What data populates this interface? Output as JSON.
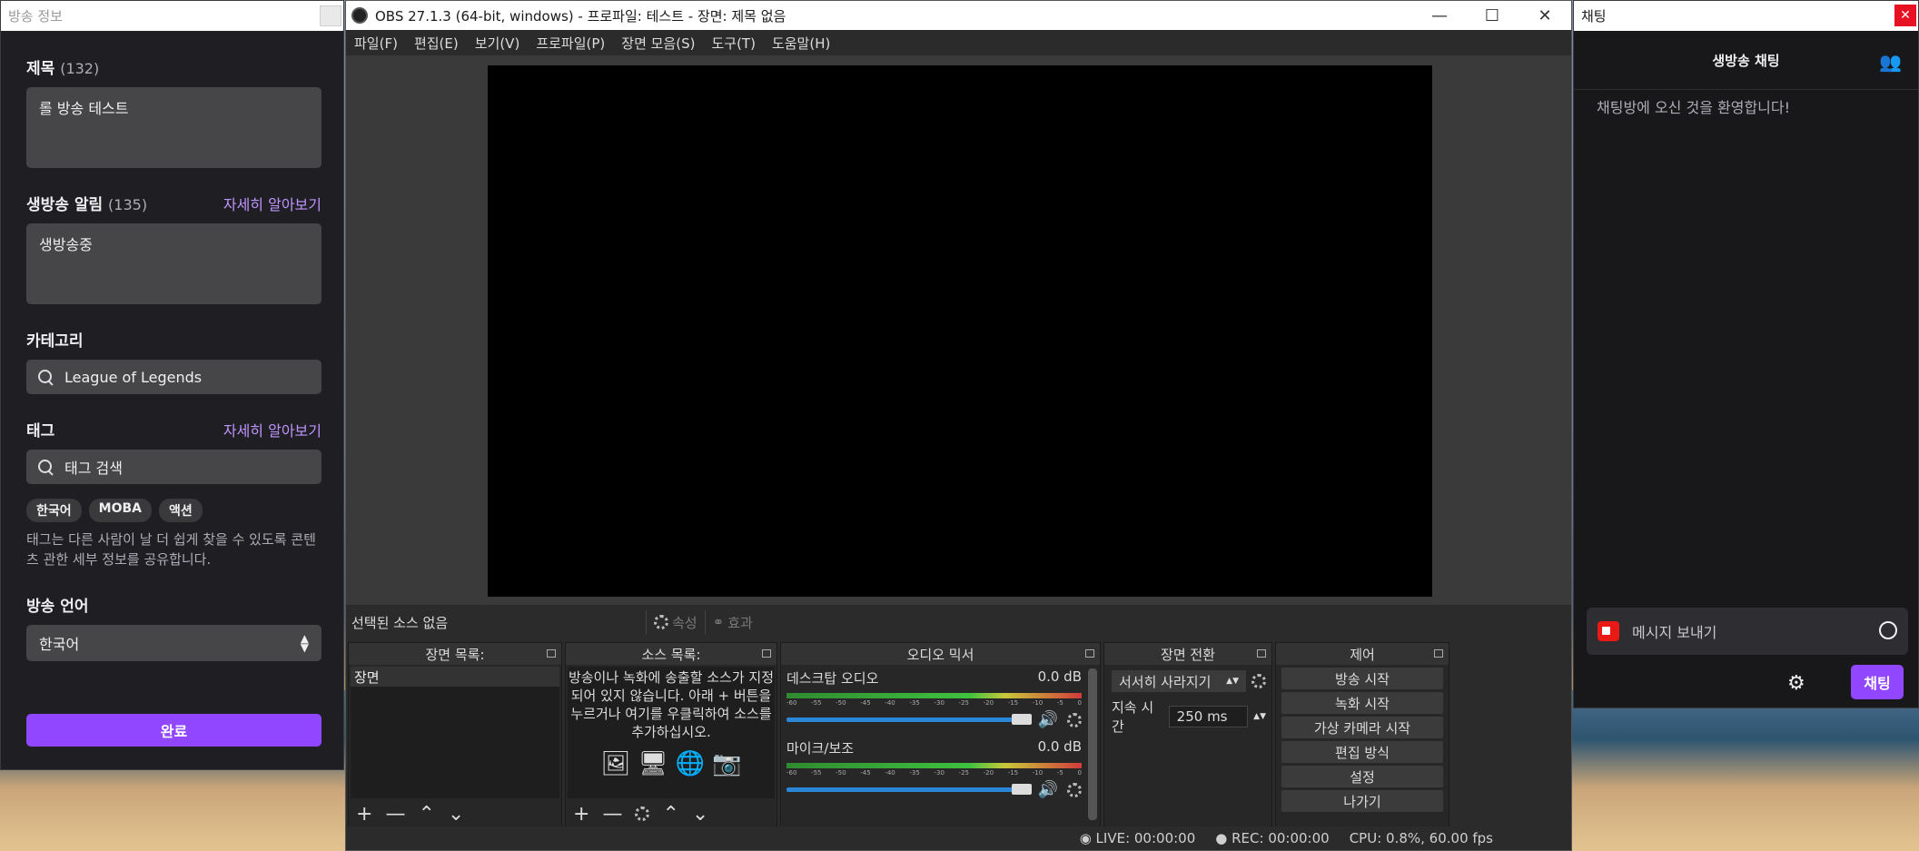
{
  "info_window": {
    "title": "방송 정보",
    "title_label": "제목",
    "title_count": "(132)",
    "title_value": "롤 방송 테스트",
    "notif_label": "생방송 알림",
    "notif_count": "(135)",
    "learn_more": "자세히 알아보기",
    "notif_value": "생방송중",
    "category_label": "카테고리",
    "category_value": "League of Legends",
    "tags_label": "태그",
    "tag_search_placeholder": "태그 검색",
    "tags": [
      "한국어",
      "MOBA",
      "액션"
    ],
    "tags_hint": "태그는 다른 사람이 날 더 쉽게 찾을 수 있도록 콘텐츠 관한 세부 정보를 공유합니다.",
    "language_label": "방송 언어",
    "language_value": "한국어",
    "done_label": "완료"
  },
  "obs": {
    "title": "OBS 27.1.3 (64-bit, windows) - 프로파일: 테스트 - 장면: 제목 없음",
    "menu": [
      "파일(F)",
      "편집(E)",
      "보기(V)",
      "프로파일(P)",
      "장면 모음(S)",
      "도구(T)",
      "도움말(H)"
    ],
    "no_source": "선택된 소스 없음",
    "props_label": "속성",
    "filters_label": "효과",
    "scenes_title": "장면 목록:",
    "scene_item": "장면",
    "sources_title": "소스 목록:",
    "sources_hint": "방송이나 녹화에 송출할 소스가 지정되어 있지 않습니다. 아래 + 버튼을 누르거나 여기를 우클릭하여 소스를 추가하십시오.",
    "mixer_title": "오디오 믹서",
    "channels": [
      {
        "name": "데스크탑 오디오",
        "db": "0.0 dB"
      },
      {
        "name": "마이크/보조",
        "db": "0.0 dB"
      }
    ],
    "meter_ticks": [
      "-60",
      "-55",
      "-50",
      "-45",
      "-40",
      "-35",
      "-30",
      "-25",
      "-20",
      "-15",
      "-10",
      "-5",
      "0"
    ],
    "transitions_title": "장면 전환",
    "transition_value": "서서히 사라지기",
    "duration_label": "지속 시간",
    "duration_value": "250 ms",
    "controls_title": "제어",
    "controls": [
      "방송 시작",
      "녹화 시작",
      "가상 카메라 시작",
      "편집 방식",
      "설정",
      "나가기"
    ],
    "status_live": "LIVE: 00:00:00",
    "status_rec": "REC: 00:00:00",
    "status_cpu": "CPU: 0.8%, 60.00 fps"
  },
  "chat_window": {
    "title": "채팅",
    "header": "생방송 채팅",
    "welcome": "채팅방에 오신 것을 환영합니다!",
    "input_placeholder": "메시지 보내기",
    "send_label": "채팅"
  }
}
